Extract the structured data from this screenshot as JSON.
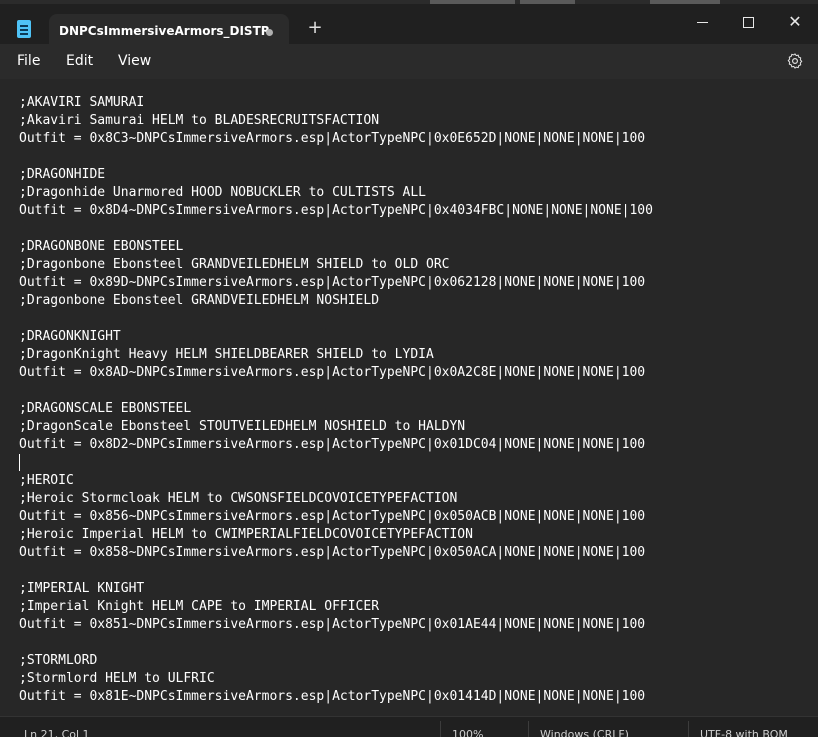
{
  "tab": {
    "title": "DNPCsImmersiveArmors_DISTR",
    "new_tab_glyph": "+"
  },
  "window_controls": {
    "close_glyph": "✕"
  },
  "menu": {
    "file": "File",
    "edit": "Edit",
    "view": "View"
  },
  "editor": {
    "lines": [
      ";AKAVIRI SAMURAI",
      ";Akaviri Samurai HELM to BLADESRECRUITSFACTION",
      "Outfit = 0x8C3~DNPCsImmersiveArmors.esp|ActorTypeNPC|0x0E652D|NONE|NONE|NONE|100",
      "",
      ";DRAGONHIDE",
      ";Dragonhide Unarmored HOOD NOBUCKLER to CULTISTS ALL",
      "Outfit = 0x8D4~DNPCsImmersiveArmors.esp|ActorTypeNPC|0x4034FBC|NONE|NONE|NONE|100",
      "",
      ";DRAGONBONE EBONSTEEL",
      ";Dragonbone Ebonsteel GRANDVEILEDHELM SHIELD to OLD ORC",
      "Outfit = 0x89D~DNPCsImmersiveArmors.esp|ActorTypeNPC|0x062128|NONE|NONE|NONE|100",
      ";Dragonbone Ebonsteel GRANDVEILEDHELM NOSHIELD",
      "",
      ";DRAGONKNIGHT",
      ";DragonKnight Heavy HELM SHIELDBEARER SHIELD to LYDIA",
      "Outfit = 0x8AD~DNPCsImmersiveArmors.esp|ActorTypeNPC|0x0A2C8E|NONE|NONE|NONE|100",
      "",
      ";DRAGONSCALE EBONSTEEL",
      ";DragonScale Ebonsteel STOUTVEILEDHELM NOSHIELD to HALDYN",
      "Outfit = 0x8D2~DNPCsImmersiveArmors.esp|ActorTypeNPC|0x01DC04|NONE|NONE|NONE|100",
      "",
      ";HEROIC",
      ";Heroic Stormcloak HELM to CWSONSFIELDCOVOICETYPEFACTION",
      "Outfit = 0x856~DNPCsImmersiveArmors.esp|ActorTypeNPC|0x050ACB|NONE|NONE|NONE|100",
      ";Heroic Imperial HELM to CWIMPERIALFIELDCOVOICETYPEFACTION",
      "Outfit = 0x858~DNPCsImmersiveArmors.esp|ActorTypeNPC|0x050ACA|NONE|NONE|NONE|100",
      "",
      ";IMPERIAL KNIGHT",
      ";Imperial Knight HELM CAPE to IMPERIAL OFFICER",
      "Outfit = 0x851~DNPCsImmersiveArmors.esp|ActorTypeNPC|0x01AE44|NONE|NONE|NONE|100",
      "",
      ";STORMLORD",
      ";Stormlord HELM to ULFRIC",
      "Outfit = 0x81E~DNPCsImmersiveArmors.esp|ActorTypeNPC|0x01414D|NONE|NONE|NONE|100"
    ]
  },
  "status": {
    "position": "Ln 21, Col 1",
    "zoom": "100%",
    "line_ending": "Windows (CRLF)",
    "encoding": "UTF-8 with BOM"
  },
  "icons": {
    "app": "notepad-icon",
    "unsaved": "unsaved-dot-icon",
    "settings": "gear-icon"
  }
}
